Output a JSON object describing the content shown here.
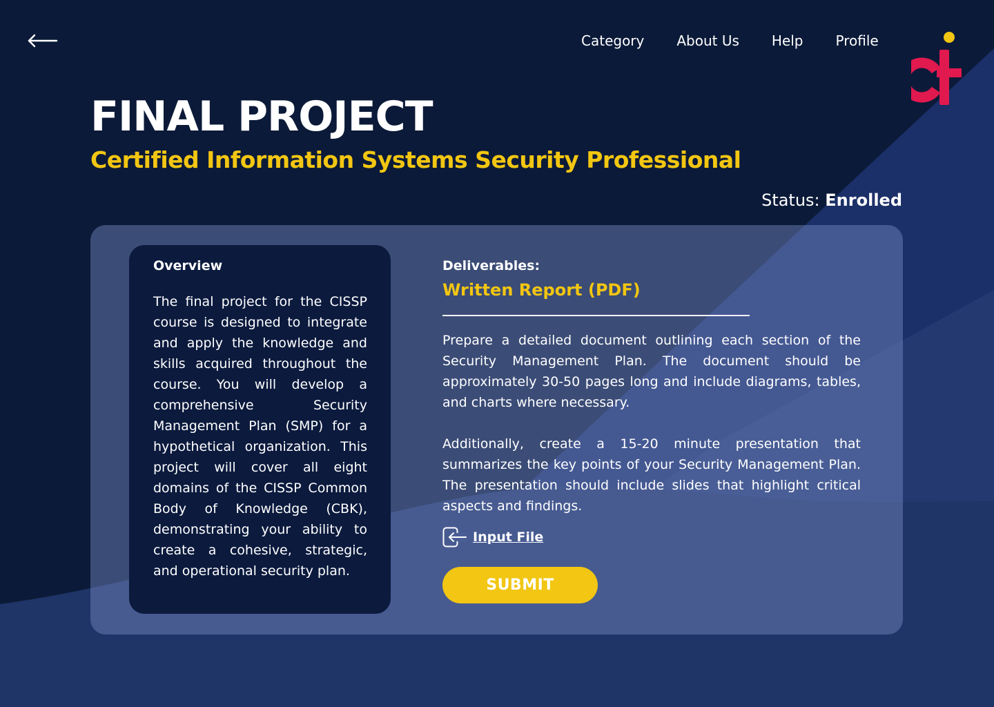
{
  "nav": {
    "items": [
      "Category",
      "About Us",
      "Help",
      "Profile"
    ]
  },
  "header": {
    "title": "FINAL PROJECT",
    "subtitle": "Certified Information Systems Security Professional"
  },
  "status": {
    "label": "Status:",
    "value": "Enrolled"
  },
  "overview": {
    "heading": "Overview",
    "body": "The final project for the CISSP course is designed to integrate and apply the knowledge and skills acquired throughout the course. You will develop a comprehensive Security Management Plan (SMP) for a hypothetical organization. This project will cover all eight domains of the CISSP Common Body of Knowledge (CBK), demonstrating your ability to create a cohesive, strategic, and operational security plan."
  },
  "deliverables": {
    "heading": "Deliverables:",
    "type": "Written Report (PDF)",
    "paragraph1": "Prepare a detailed document outlining each section of the Security Management Plan. The document should be approximately 30-50 pages long and include diagrams, tables, and charts where necessary.",
    "paragraph2": "Additionally, create a 15-20 minute presentation that summarizes the key points of your Security Management Plan. The presentation should include slides that highlight critical aspects and findings."
  },
  "actions": {
    "input_file_label": "Input File",
    "submit_label": "SUBMIT"
  },
  "icons": {
    "back": "arrow-left-icon",
    "input_file": "file-input-icon",
    "logo": "ci-logo"
  },
  "colors": {
    "background": "#0b1a38",
    "accent_yellow": "#f2c612",
    "logo_red": "#e0194f",
    "panel": "#7e92ce",
    "card": "#0b1a3d"
  }
}
